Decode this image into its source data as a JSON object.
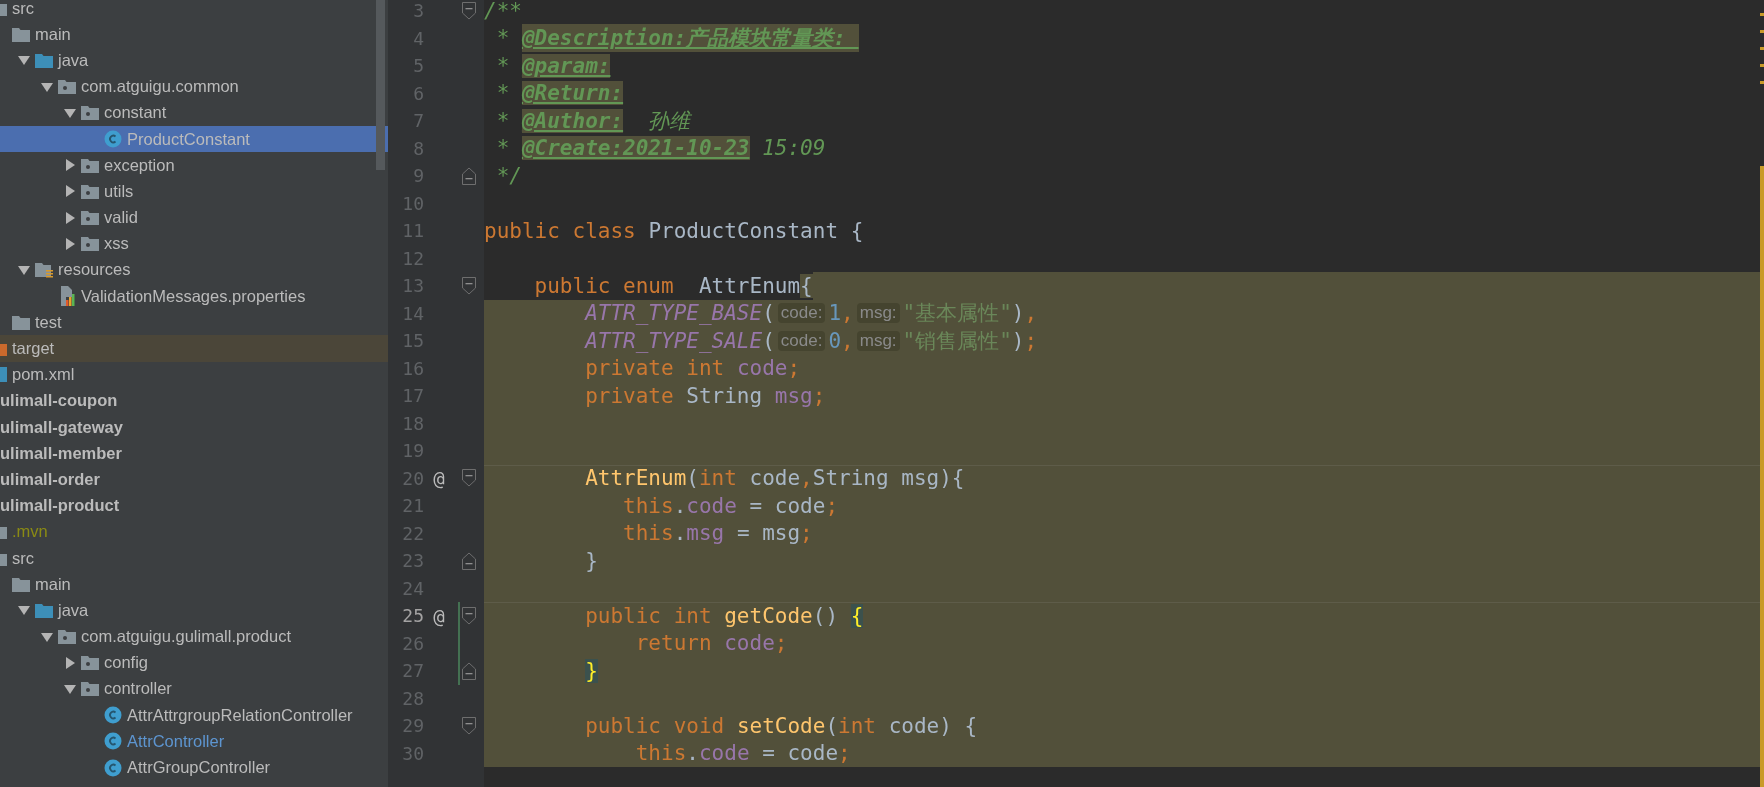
{
  "project_tree": {
    "items": [
      {
        "label": "src",
        "kind": "folder",
        "selected": false,
        "children": [
          {
            "label": "main",
            "kind": "folder",
            "selected": false,
            "children": [
              {
                "label": "java",
                "kind": "source-folder",
                "selected": false,
                "expanded": true,
                "children": [
                  {
                    "label": "com.atguigu.common",
                    "kind": "package",
                    "selected": false,
                    "expanded": true,
                    "children": [
                      {
                        "label": "constant",
                        "kind": "package",
                        "selected": false,
                        "expanded": true,
                        "children": [
                          {
                            "label": "ProductConstant",
                            "kind": "class",
                            "selected": true,
                            "modified": false
                          }
                        ]
                      },
                      {
                        "label": "exception",
                        "kind": "package",
                        "selected": false,
                        "expanded": false
                      },
                      {
                        "label": "utils",
                        "kind": "package",
                        "selected": false,
                        "expanded": false
                      },
                      {
                        "label": "valid",
                        "kind": "package",
                        "selected": false,
                        "expanded": false
                      },
                      {
                        "label": "xss",
                        "kind": "package",
                        "selected": false,
                        "expanded": false
                      }
                    ]
                  }
                ]
              },
              {
                "label": "resources",
                "kind": "resources-folder",
                "selected": false,
                "expanded": true,
                "children": [
                  {
                    "label": "ValidationMessages.properties",
                    "kind": "properties-file",
                    "selected": false
                  }
                ]
              }
            ]
          },
          {
            "label": "test",
            "kind": "folder",
            "selected": false
          }
        ]
      },
      {
        "label": "target",
        "kind": "excluded-folder",
        "selected": false
      },
      {
        "label": "pom.xml",
        "kind": "maven-file",
        "selected": false
      },
      {
        "label": "ulimall-coupon",
        "kind": "module",
        "selected": false
      },
      {
        "label": "ulimall-gateway",
        "kind": "module",
        "selected": false
      },
      {
        "label": "ulimall-member",
        "kind": "module",
        "selected": false
      },
      {
        "label": "ulimall-order",
        "kind": "module",
        "selected": false
      },
      {
        "label": "ulimall-product",
        "kind": "module",
        "selected": false,
        "children": [
          {
            "label": ".mvn",
            "kind": "ignored-folder",
            "selected": false
          },
          {
            "label": "src",
            "kind": "folder",
            "selected": false,
            "children": [
              {
                "label": "main",
                "kind": "folder",
                "selected": false,
                "children": [
                  {
                    "label": "java",
                    "kind": "source-folder",
                    "selected": false,
                    "expanded": true,
                    "children": [
                      {
                        "label": "com.atguigu.gulimall.product",
                        "kind": "package",
                        "selected": false,
                        "expanded": true,
                        "children": [
                          {
                            "label": "config",
                            "kind": "package",
                            "selected": false,
                            "expanded": false
                          },
                          {
                            "label": "controller",
                            "kind": "package",
                            "selected": false,
                            "expanded": true,
                            "children": [
                              {
                                "label": "AttrAttrgroupRelationController",
                                "kind": "class",
                                "selected": false,
                                "modified": false
                              },
                              {
                                "label": "AttrController",
                                "kind": "class",
                                "selected": false,
                                "modified": true
                              },
                              {
                                "label": "AttrGroupController",
                                "kind": "class",
                                "selected": false,
                                "modified": false
                              }
                            ]
                          }
                        ]
                      }
                    ]
                  }
                ]
              }
            ]
          }
        ]
      }
    ]
  },
  "editor": {
    "lines": [
      {
        "number": "3",
        "fold": {
          "kind": "start"
        },
        "highlighted": false,
        "tokens": [
          {
            "kind": "comment",
            "s": "/**"
          }
        ]
      },
      {
        "number": "4",
        "highlighted": false,
        "tokens": [
          {
            "kind": "comment",
            "s": " * "
          },
          {
            "kind": "doctag",
            "s": "@Description:产品模块常量类: "
          }
        ]
      },
      {
        "number": "5",
        "highlighted": false,
        "tokens": [
          {
            "kind": "comment",
            "s": " * "
          },
          {
            "kind": "doctag",
            "s": "@param:"
          }
        ]
      },
      {
        "number": "6",
        "highlighted": false,
        "tokens": [
          {
            "kind": "comment",
            "s": " * "
          },
          {
            "kind": "doctag",
            "s": "@Return:"
          }
        ]
      },
      {
        "number": "7",
        "highlighted": false,
        "tokens": [
          {
            "kind": "comment",
            "s": " * "
          },
          {
            "kind": "doctag",
            "s": "@Author:"
          },
          {
            "kind": "comment",
            "s": "  孙维"
          }
        ]
      },
      {
        "number": "8",
        "highlighted": false,
        "tokens": [
          {
            "kind": "comment",
            "s": " * "
          },
          {
            "kind": "doctag",
            "s": "@Create:2021-10-23"
          },
          {
            "kind": "comment",
            "s": " 15:09"
          }
        ]
      },
      {
        "number": "9",
        "fold": {
          "kind": "end"
        },
        "highlighted": false,
        "tokens": [
          {
            "kind": "comment",
            "s": " */"
          }
        ]
      },
      {
        "number": "10",
        "highlighted": false
      },
      {
        "number": "11",
        "highlighted": false,
        "tokens": [
          {
            "kind": "kw",
            "s": "public class "
          },
          {
            "kind": "plain",
            "s": "ProductConstant {"
          }
        ]
      },
      {
        "number": "12",
        "highlighted": false
      },
      {
        "number": "13",
        "fold": {
          "kind": "start"
        },
        "highlighted": false,
        "tokens": [
          {
            "kind": "kw",
            "s": "    public enum  ",
            "highlighted": false
          },
          {
            "kind": "plain",
            "s": "AttrEnum",
            "highlighted": false
          },
          {
            "kind": "plain",
            "s": "{",
            "highlighted": true
          }
        ]
      },
      {
        "number": "14",
        "highlighted": true,
        "tokens": [
          {
            "kind": "const",
            "s": "        ATTR_TYPE_BASE"
          },
          {
            "kind": "plain",
            "s": "("
          },
          {
            "kind": "hint",
            "s": "code:"
          },
          {
            "kind": "num",
            "s": "1"
          },
          {
            "kind": "kw",
            "s": ","
          },
          {
            "kind": "hint",
            "s": "msg:"
          },
          {
            "kind": "str",
            "s": "\"基本属性\""
          },
          {
            "kind": "plain",
            "s": ")"
          },
          {
            "kind": "kw",
            "s": ","
          }
        ]
      },
      {
        "number": "15",
        "highlighted": true,
        "tokens": [
          {
            "kind": "const",
            "s": "        ATTR_TYPE_SALE"
          },
          {
            "kind": "plain",
            "s": "("
          },
          {
            "kind": "hint",
            "s": "code:"
          },
          {
            "kind": "num",
            "s": "0"
          },
          {
            "kind": "kw",
            "s": ","
          },
          {
            "kind": "hint",
            "s": "msg:"
          },
          {
            "kind": "str",
            "s": "\"销售属性\""
          },
          {
            "kind": "plain",
            "s": ")"
          },
          {
            "kind": "kw",
            "s": ";"
          }
        ]
      },
      {
        "number": "16",
        "highlighted": true,
        "tokens": [
          {
            "kind": "kw",
            "s": "        private int "
          },
          {
            "kind": "field",
            "s": "code"
          },
          {
            "kind": "kw",
            "s": ";"
          }
        ]
      },
      {
        "number": "17",
        "highlighted": true,
        "tokens": [
          {
            "kind": "kw",
            "s": "        private "
          },
          {
            "kind": "plain",
            "s": "String "
          },
          {
            "kind": "field",
            "s": "msg"
          },
          {
            "kind": "kw",
            "s": ";"
          }
        ]
      },
      {
        "number": "18",
        "highlighted": true
      },
      {
        "number": "19",
        "highlighted": true
      },
      {
        "number": "20",
        "marker": "@",
        "fold": {
          "kind": "start"
        },
        "separator": true,
        "highlighted": true,
        "tokens": [
          {
            "kind": "method",
            "s": "        AttrEnum"
          },
          {
            "kind": "plain",
            "s": "("
          },
          {
            "kind": "kw",
            "s": "int "
          },
          {
            "kind": "plain",
            "s": "code"
          },
          {
            "kind": "kw",
            "s": ","
          },
          {
            "kind": "plain",
            "s": "String msg){"
          }
        ]
      },
      {
        "number": "21",
        "highlighted": true,
        "tokens": [
          {
            "kind": "kw",
            "s": "           this"
          },
          {
            "kind": "plain",
            "s": "."
          },
          {
            "kind": "field",
            "s": "code"
          },
          {
            "kind": "plain",
            "s": " = code"
          },
          {
            "kind": "kw",
            "s": ";"
          }
        ]
      },
      {
        "number": "22",
        "highlighted": true,
        "tokens": [
          {
            "kind": "kw",
            "s": "           this"
          },
          {
            "kind": "plain",
            "s": "."
          },
          {
            "kind": "field",
            "s": "msg"
          },
          {
            "kind": "plain",
            "s": " = msg"
          },
          {
            "kind": "kw",
            "s": ";"
          }
        ]
      },
      {
        "number": "23",
        "fold": {
          "kind": "end"
        },
        "highlighted": true,
        "tokens": [
          {
            "kind": "plain",
            "s": "        }"
          }
        ]
      },
      {
        "number": "24",
        "highlighted": true
      },
      {
        "number": "25",
        "marker": "@",
        "fold": {
          "kind": "start"
        },
        "current": true,
        "changed": true,
        "separator": true,
        "highlighted": true,
        "tokens": [
          {
            "kind": "kw",
            "s": "        public int "
          },
          {
            "kind": "method",
            "s": "getCode"
          },
          {
            "kind": "plain",
            "s": "() "
          },
          {
            "kind": "brace",
            "s": "{"
          }
        ]
      },
      {
        "number": "26",
        "changed": true,
        "highlighted": true,
        "tokens": [
          {
            "kind": "kw",
            "s": "            return "
          },
          {
            "kind": "field",
            "s": "code"
          },
          {
            "kind": "kw",
            "s": ";"
          }
        ]
      },
      {
        "number": "27",
        "fold": {
          "kind": "end"
        },
        "changed": true,
        "highlighted": true,
        "tokens": [
          {
            "kind": "brace",
            "s": "        }"
          }
        ]
      },
      {
        "number": "28",
        "highlighted": true
      },
      {
        "number": "29",
        "fold": {
          "kind": "start"
        },
        "highlighted": true,
        "tokens": [
          {
            "kind": "kw",
            "s": "        public void "
          },
          {
            "kind": "method",
            "s": "setCode"
          },
          {
            "kind": "plain",
            "s": "("
          },
          {
            "kind": "kw",
            "s": "int "
          },
          {
            "kind": "plain",
            "s": "code) {"
          }
        ]
      },
      {
        "number": "30",
        "highlighted": true,
        "tokens": [
          {
            "kind": "kw",
            "s": "            this"
          },
          {
            "kind": "plain",
            "s": "."
          },
          {
            "kind": "field",
            "s": "code"
          },
          {
            "kind": "plain",
            "s": " = code"
          },
          {
            "kind": "kw",
            "s": ";"
          }
        ]
      }
    ]
  }
}
